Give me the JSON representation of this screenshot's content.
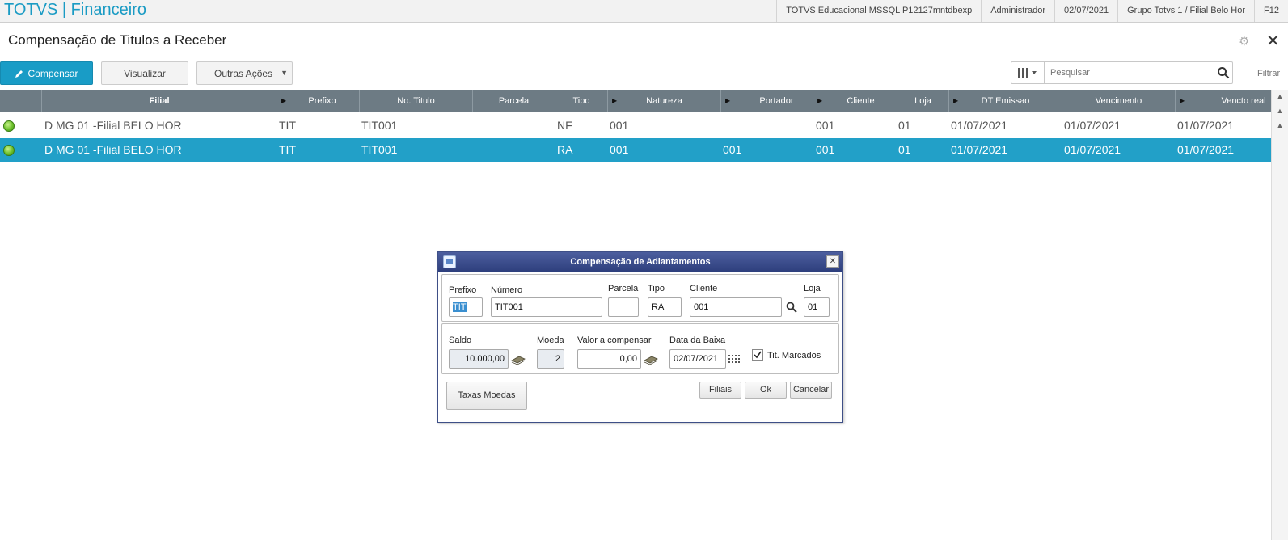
{
  "topbar": {
    "brand": "TOTVS | Financeiro",
    "environment": "TOTVS Educacional MSSQL P12127mntdbexp",
    "user": "Administrador",
    "date": "02/07/2021",
    "branch": "Grupo Totvs 1 / Filial Belo Hor",
    "shortcut": "F12"
  },
  "page": {
    "title": "Compensação de Titulos a Receber"
  },
  "toolbar": {
    "compensar_label": "Compensar",
    "visualizar_label": "Visualizar",
    "outras_acoes_label": "Outras Ações",
    "search_placeholder": "Pesquisar",
    "filtrar_label": "Filtrar"
  },
  "grid": {
    "columns": [
      "Filial",
      "Prefixo",
      "No. Titulo",
      "Parcela",
      "Tipo",
      "Natureza",
      "Portador",
      "Cliente",
      "Loja",
      "DT Emissao",
      "Vencimento",
      "Vencto real"
    ],
    "rows": [
      {
        "filial": "D MG 01 -Filial BELO HOR",
        "prefixo": "TIT",
        "numero": "TIT001",
        "parcela": "",
        "tipo": "NF",
        "natureza": "001",
        "portador": "",
        "cliente": "001",
        "loja": "01",
        "emissao": "01/07/2021",
        "vencimento": "01/07/2021",
        "vencto_real": "01/07/2021"
      },
      {
        "filial": "D MG 01 -Filial BELO HOR",
        "prefixo": "TIT",
        "numero": "TIT001",
        "parcela": "",
        "tipo": "RA",
        "natureza": "001",
        "portador": "001",
        "cliente": "001",
        "loja": "01",
        "emissao": "01/07/2021",
        "vencimento": "01/07/2021",
        "vencto_real": "01/07/2021"
      }
    ]
  },
  "dialog": {
    "title": "Compensação de Adiantamentos",
    "labels": {
      "prefixo": "Prefixo",
      "numero": "Número",
      "parcela": "Parcela",
      "tipo": "Tipo",
      "cliente": "Cliente",
      "loja": "Loja",
      "saldo": "Saldo",
      "moeda": "Moeda",
      "valor": "Valor a compensar",
      "data_baixa": "Data da Baixa",
      "tit_marcados": "Tit. Marcados"
    },
    "values": {
      "prefixo": "TIT",
      "numero": "TIT001",
      "parcela": "",
      "tipo": "RA",
      "cliente": "001",
      "loja": "01",
      "saldo": "10.000,00",
      "moeda": "2",
      "valor": "0,00",
      "data_baixa": "02/07/2021"
    },
    "tit_marcados_checked": true,
    "buttons": {
      "taxas_moedas": "Taxas Moedas",
      "filiais": "Filiais",
      "ok": "Ok",
      "cancelar": "Cancelar"
    }
  },
  "colors": {
    "brand": "#1a9bc4",
    "primary_button": "#199cc6",
    "grid_header": "#6d7b84",
    "selected_row": "#22a0c8",
    "dialog_title": "#3a4b8a"
  }
}
